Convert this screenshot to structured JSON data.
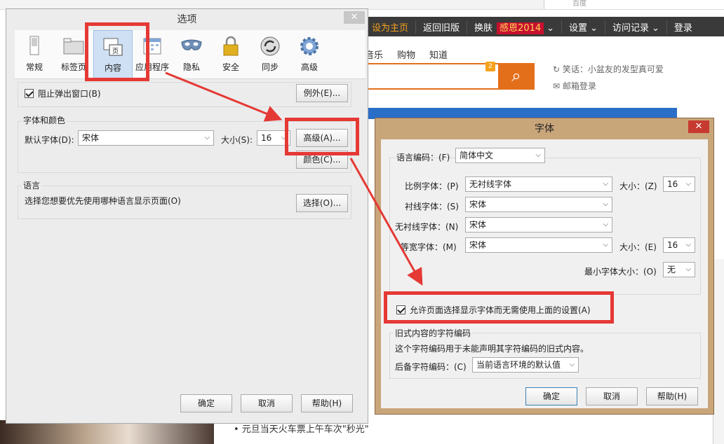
{
  "browser": {
    "search_engine_hint": "百度",
    "nav": {
      "set_home": "设为主页",
      "old_version": "返回旧版",
      "skin": "换肤",
      "event_badge": "感恩2014",
      "settings": "设置",
      "history": "访问记录",
      "login": "登录"
    },
    "categories": [
      "音乐",
      "购物",
      "知道"
    ],
    "search_count": "2",
    "joke": "笑话：小盆友的发型真可爱",
    "mailbox_login": "邮箱登录",
    "news_item": "• 元旦当天火车票上午车次\"秒光\""
  },
  "options_dialog": {
    "title": "选项",
    "close": "✕",
    "tabs": [
      {
        "label": "常规",
        "icon": "switch-icon"
      },
      {
        "label": "标签页",
        "icon": "tabs-icon"
      },
      {
        "label": "内容",
        "icon": "page-icon"
      },
      {
        "label": "应用程序",
        "icon": "calendar-icon"
      },
      {
        "label": "隐私",
        "icon": "mask-icon"
      },
      {
        "label": "安全",
        "icon": "lock-icon"
      },
      {
        "label": "同步",
        "icon": "sync-icon"
      },
      {
        "label": "高级",
        "icon": "gear-icon"
      }
    ],
    "block_popups": "阻止弹出窗口(B)",
    "exceptions": "例外(E)...",
    "fonts_colors_title": "字体和颜色",
    "default_font_label": "默认字体(D):",
    "default_font_value": "宋体",
    "size_label": "大小(S):",
    "size_value": "16",
    "advanced": "高级(A)...",
    "colors": "颜色(C)...",
    "language_title": "语言",
    "language_desc": "选择您想要优先使用哪种语言显示页面(O)",
    "choose": "选择(O)...",
    "ok": "确定",
    "cancel": "取消",
    "help": "帮助(H)"
  },
  "fonts_dialog": {
    "title": "字体",
    "close": "✕",
    "encoding_label": "语言编码：(F)",
    "encoding_value": "简体中文",
    "proportional_label": "比例字体：(P)",
    "proportional_value": "无衬线字体",
    "size1_label": "大小：(Z)",
    "size1_value": "16",
    "serif_label": "衬线字体：(S)",
    "serif_value": "宋体",
    "sans_label": "无衬线字体：(N)",
    "sans_value": "宋体",
    "mono_label": "等宽字体：(M)",
    "mono_value": "宋体",
    "size2_label": "大小：(E)",
    "size2_value": "16",
    "min_size_label": "最小字体大小：(O)",
    "min_size_value": "无",
    "allow_pages": "允许页面选择显示字体而无需使用上面的设置(A)",
    "legacy_title": "旧式内容的字符编码",
    "legacy_desc": "这个字符编码用于未能声明其字符编码的旧式内容。",
    "fallback_label": "后备字符编码：(C)",
    "fallback_value": "当前语言环境的默认值",
    "ok": "确定",
    "cancel": "取消",
    "help": "帮助(H)"
  },
  "colors": {
    "highlight": "#e53935",
    "accent_orange": "#e46f1b",
    "fonts_frame": "#c9a57a"
  }
}
